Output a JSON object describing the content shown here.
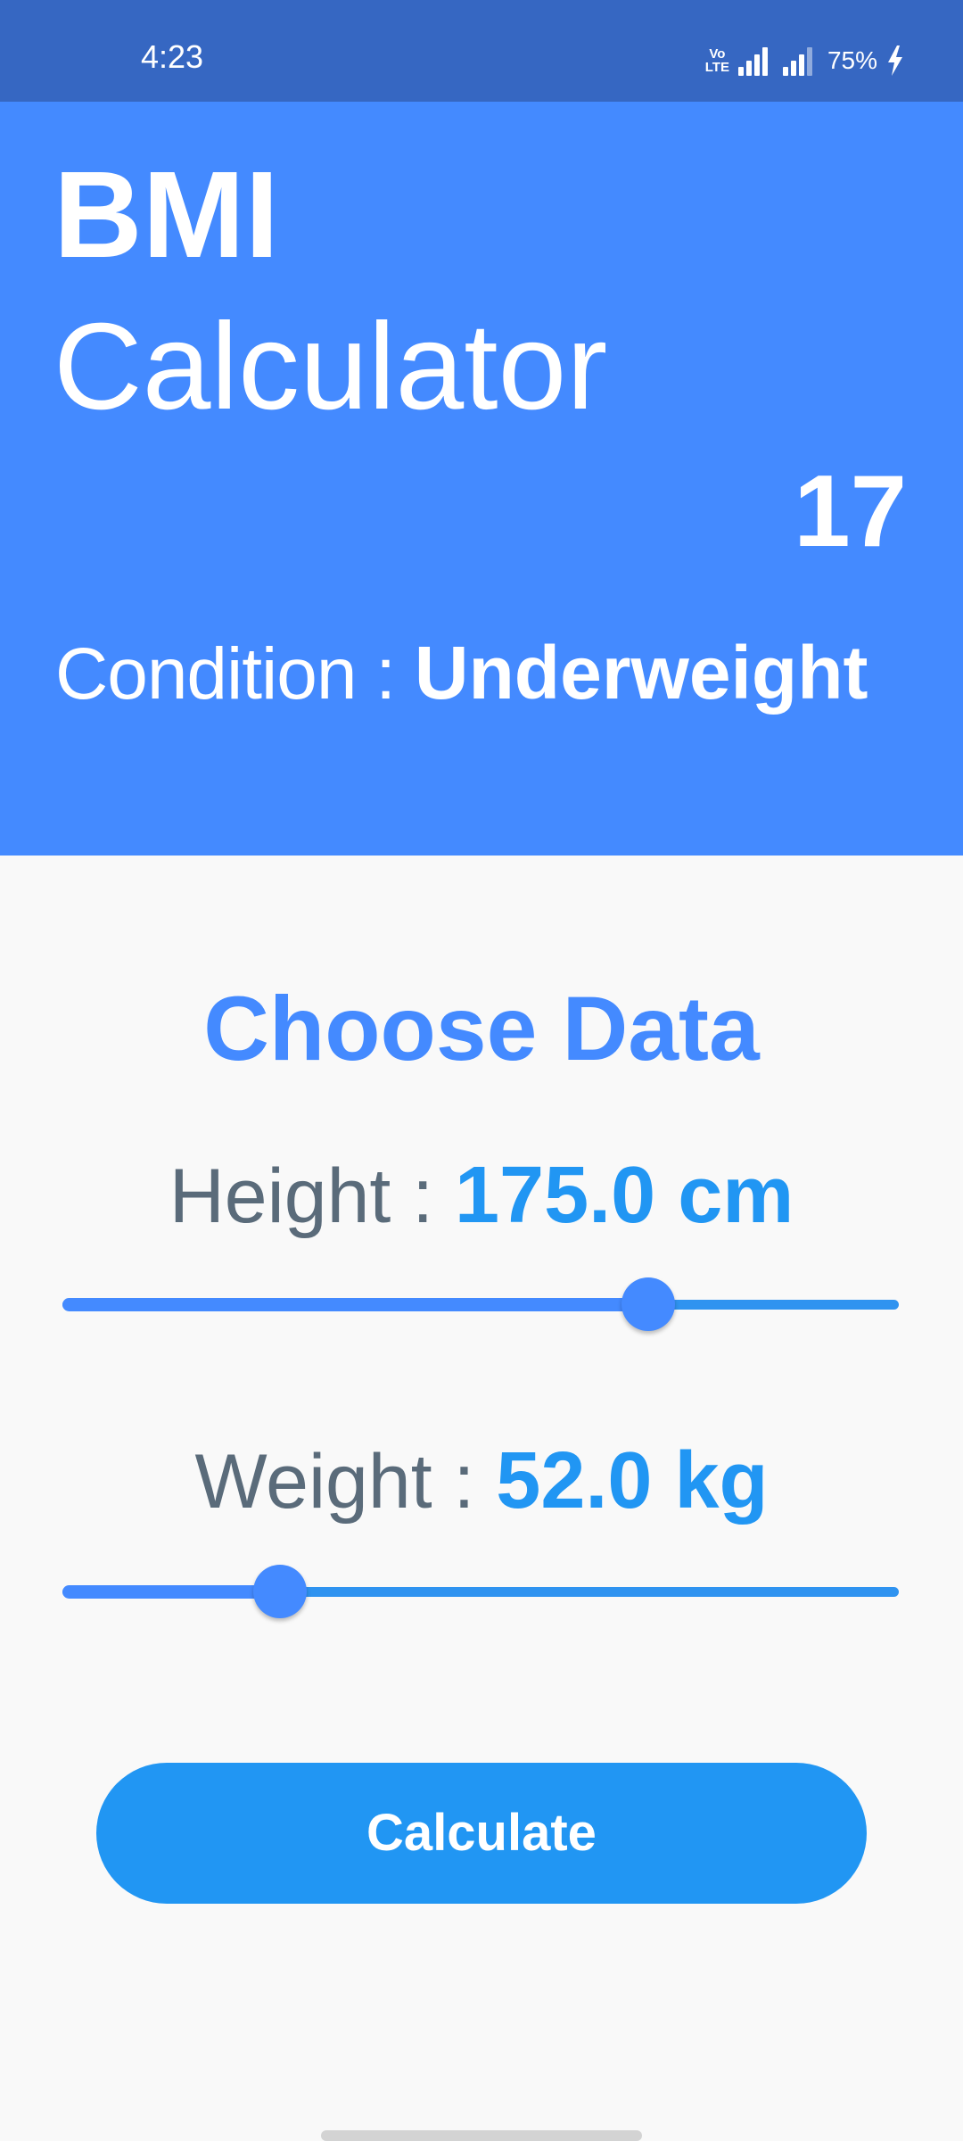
{
  "status_bar": {
    "time": "4:23",
    "volte_top": "Vo",
    "volte_bottom": "LTE",
    "battery": "75%",
    "icons": [
      "volte-icon",
      "signal-icon",
      "signal-icon",
      "charging-icon"
    ],
    "background": "#3667c2"
  },
  "header": {
    "title_line1": "BMI",
    "title_line2": "Calculator",
    "bmi_value": "17",
    "condition_label": "Condition : ",
    "condition_value": "Underweight",
    "background": "#448aff"
  },
  "main": {
    "section_title": "Choose Data",
    "height": {
      "label": "Height : ",
      "value": "175.0 cm",
      "slider_fraction": 0.7
    },
    "weight": {
      "label": "Weight : ",
      "value": "52.0 kg",
      "slider_fraction": 0.26
    },
    "calculate_label": "Calculate"
  },
  "colors": {
    "accent": "#448aff",
    "button": "#2196f3",
    "background": "#f9f9f9"
  }
}
